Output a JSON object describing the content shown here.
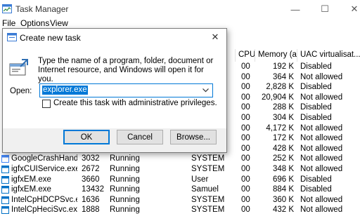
{
  "window": {
    "title": "Task Manager",
    "controls": {
      "minimize": "—",
      "maximize": "☐",
      "close": "✕"
    }
  },
  "menu": [
    "File",
    "Options",
    "View"
  ],
  "columns": {
    "cpu": "CPU",
    "memory": "Memory (a...",
    "uac": "UAC virtualisat..."
  },
  "rows": [
    {
      "name": "",
      "pid": "",
      "status": "",
      "user": "",
      "cpu": "00",
      "memory": "192 K",
      "uac": "Disabled",
      "icon": "process-icon"
    },
    {
      "name": "",
      "pid": "",
      "status": "",
      "user": "",
      "cpu": "00",
      "memory": "364 K",
      "uac": "Not allowed",
      "icon": "process-icon"
    },
    {
      "name": "",
      "pid": "",
      "status": "",
      "user": "",
      "cpu": "00",
      "memory": "2,828 K",
      "uac": "Disabled",
      "icon": "process-icon"
    },
    {
      "name": "",
      "pid": "",
      "status": "",
      "user": "",
      "cpu": "00",
      "memory": "20,904 K",
      "uac": "Not allowed",
      "icon": "process-icon"
    },
    {
      "name": "",
      "pid": "",
      "status": "",
      "user": "",
      "cpu": "00",
      "memory": "288 K",
      "uac": "Disabled",
      "icon": "process-icon"
    },
    {
      "name": "",
      "pid": "",
      "status": "",
      "user": "",
      "cpu": "00",
      "memory": "304 K",
      "uac": "Disabled",
      "icon": "process-icon"
    },
    {
      "name": "",
      "pid": "",
      "status": "",
      "user": "",
      "cpu": "00",
      "memory": "4,172 K",
      "uac": "Not allowed",
      "icon": "process-icon"
    },
    {
      "name": "",
      "pid": "",
      "status": "",
      "user": "",
      "cpu": "00",
      "memory": "172 K",
      "uac": "Not allowed",
      "icon": "process-icon"
    },
    {
      "name": "",
      "pid": "",
      "status": "",
      "user": "",
      "cpu": "00",
      "memory": "428 K",
      "uac": "Not allowed",
      "icon": "process-icon"
    },
    {
      "name": "GoogleCrashHandler...",
      "pid": "3032",
      "status": "Running",
      "user": "SYSTEM",
      "cpu": "00",
      "memory": "252 K",
      "uac": "Not allowed",
      "icon": "google-icon"
    },
    {
      "name": "igfxCUIService.exe",
      "pid": "2672",
      "status": "Running",
      "user": "SYSTEM",
      "cpu": "00",
      "memory": "348 K",
      "uac": "Not allowed",
      "icon": "intel-icon"
    },
    {
      "name": "igfxEM.exe",
      "pid": "3660",
      "status": "Running",
      "user": "User",
      "cpu": "00",
      "memory": "696 K",
      "uac": "Disabled",
      "icon": "intel-icon"
    },
    {
      "name": "igfxEM.exe",
      "pid": "13432",
      "status": "Running",
      "user": "Samuel",
      "cpu": "00",
      "memory": "884 K",
      "uac": "Disabled",
      "icon": "intel-icon"
    },
    {
      "name": "IntelCpHDCPSvc.exe",
      "pid": "1636",
      "status": "Running",
      "user": "SYSTEM",
      "cpu": "00",
      "memory": "360 K",
      "uac": "Not allowed",
      "icon": "intel-icon"
    },
    {
      "name": "IntelCpHeciSvc.exe",
      "pid": "1888",
      "status": "Running",
      "user": "SYSTEM",
      "cpu": "00",
      "memory": "432 K",
      "uac": "Not allowed",
      "icon": "intel-icon"
    }
  ],
  "dialog": {
    "title": "Create new task",
    "close": "✕",
    "description": "Type the name of a program, folder, document or Internet resource, and Windows will open it for you.",
    "open_label": "Open:",
    "open_value": "explorer.exe",
    "admin_label": "Create this task with administrative privileges.",
    "admin_checked": false,
    "ok_label": "OK",
    "cancel_label": "Cancel",
    "browse_label": "Browse..."
  },
  "colors": {
    "accent": "#0078d7",
    "dialog_bg": "#f0f0f0",
    "button_bg": "#e1e1e1"
  }
}
